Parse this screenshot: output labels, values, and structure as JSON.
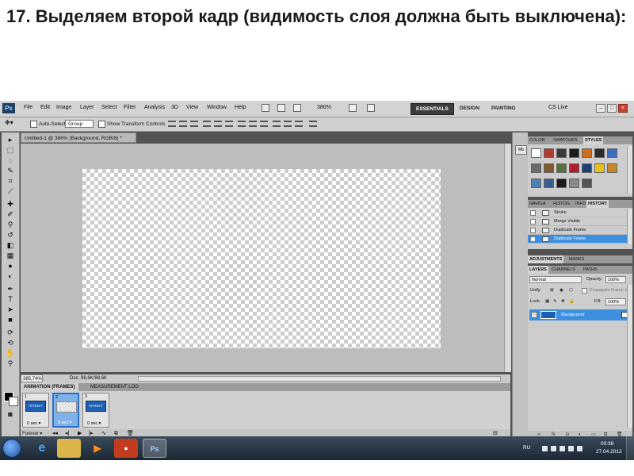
{
  "slide": {
    "title": "17. Выделяем второй кадр (видимость слоя должна быть выключена):"
  },
  "app": {
    "logo": "Ps",
    "menu": [
      "File",
      "Edit",
      "Image",
      "Layer",
      "Select",
      "Filter",
      "Analysis",
      "3D",
      "View",
      "Window",
      "Help"
    ],
    "zoom_menu": "386%",
    "workspaces": [
      "ESSENTIALS",
      "DESIGN",
      "PAINTING"
    ],
    "active_workspace": "ESSENTIALS",
    "cs_live": "CS Live",
    "window_buttons": [
      "–",
      "□",
      "×"
    ]
  },
  "options": {
    "auto_select_label": "Auto-Select:",
    "auto_select_value": "Group",
    "show_transform_label": "Show Transform Controls"
  },
  "document": {
    "tab_title": "Untitled-1 @ 386% (Background, RGB/8) *",
    "zoom": "385,74%",
    "doc_size": "Doc: 98,6K/98,6K"
  },
  "animation": {
    "tabs": [
      "ANIMATION (FRAMES)",
      "MEASUREMENT LOG"
    ],
    "active_tab": "ANIMATION (FRAMES)",
    "frames": [
      {
        "num": "1",
        "delay": "0 sec.▾",
        "thumb_label": "ПРИВЕТ",
        "selected": false,
        "empty": false
      },
      {
        "num": "2",
        "delay": "0 sec.▾",
        "thumb_label": "",
        "selected": true,
        "empty": true
      },
      {
        "num": "3",
        "delay": "0 sec.▾",
        "thumb_label": "ПРИВЕТ",
        "selected": false,
        "empty": false
      }
    ],
    "loop": "Forever ▾"
  },
  "panels": {
    "color_tabs": [
      "COLOR",
      "SWATCHES",
      "STYLES"
    ],
    "active_color_tab": "STYLES",
    "style_swatches": [
      "#ffffff",
      "#b23a2a",
      "#3a3a3a",
      "#1b1b1b",
      "#cf6d18",
      "#2b2b2b",
      "#3a6fbf",
      "#6b6b6b",
      "#7d5a2d",
      "#58713a",
      "#b01a2e",
      "#1c3f7a",
      "#e9c018",
      "#c8862a",
      "#4f7fb8",
      "#3c5b8f",
      "#1b1b1b",
      "#8a8a8a",
      "#545454"
    ],
    "history_tabs": [
      "NAVIGA",
      "HISTOG",
      "INFO",
      "HISTORY"
    ],
    "active_history_tab": "HISTORY",
    "history": [
      "Stroke",
      "Merge Visible",
      "Duplicate Frame",
      "Duplicate Frame"
    ],
    "history_selected": 3,
    "adjust_tabs": [
      "ADJUSTMENTS",
      "MASKS"
    ],
    "layers_tabs": [
      "LAYERS",
      "CHANNELS",
      "PATHS"
    ],
    "active_layers_tab": "LAYERS",
    "blend_mode": "Normal",
    "opacity_label": "Opacity:",
    "opacity_value": "100%",
    "unify_label": "Unify:",
    "propagate_label": "Propagate Frame 1",
    "lock_label": "Lock:",
    "fill_label": "Fill:",
    "fill_value": "100%",
    "layer_name": "Background"
  },
  "taskbar": {
    "lang": "RU",
    "time": "00:38",
    "date": "27.04.2012"
  }
}
